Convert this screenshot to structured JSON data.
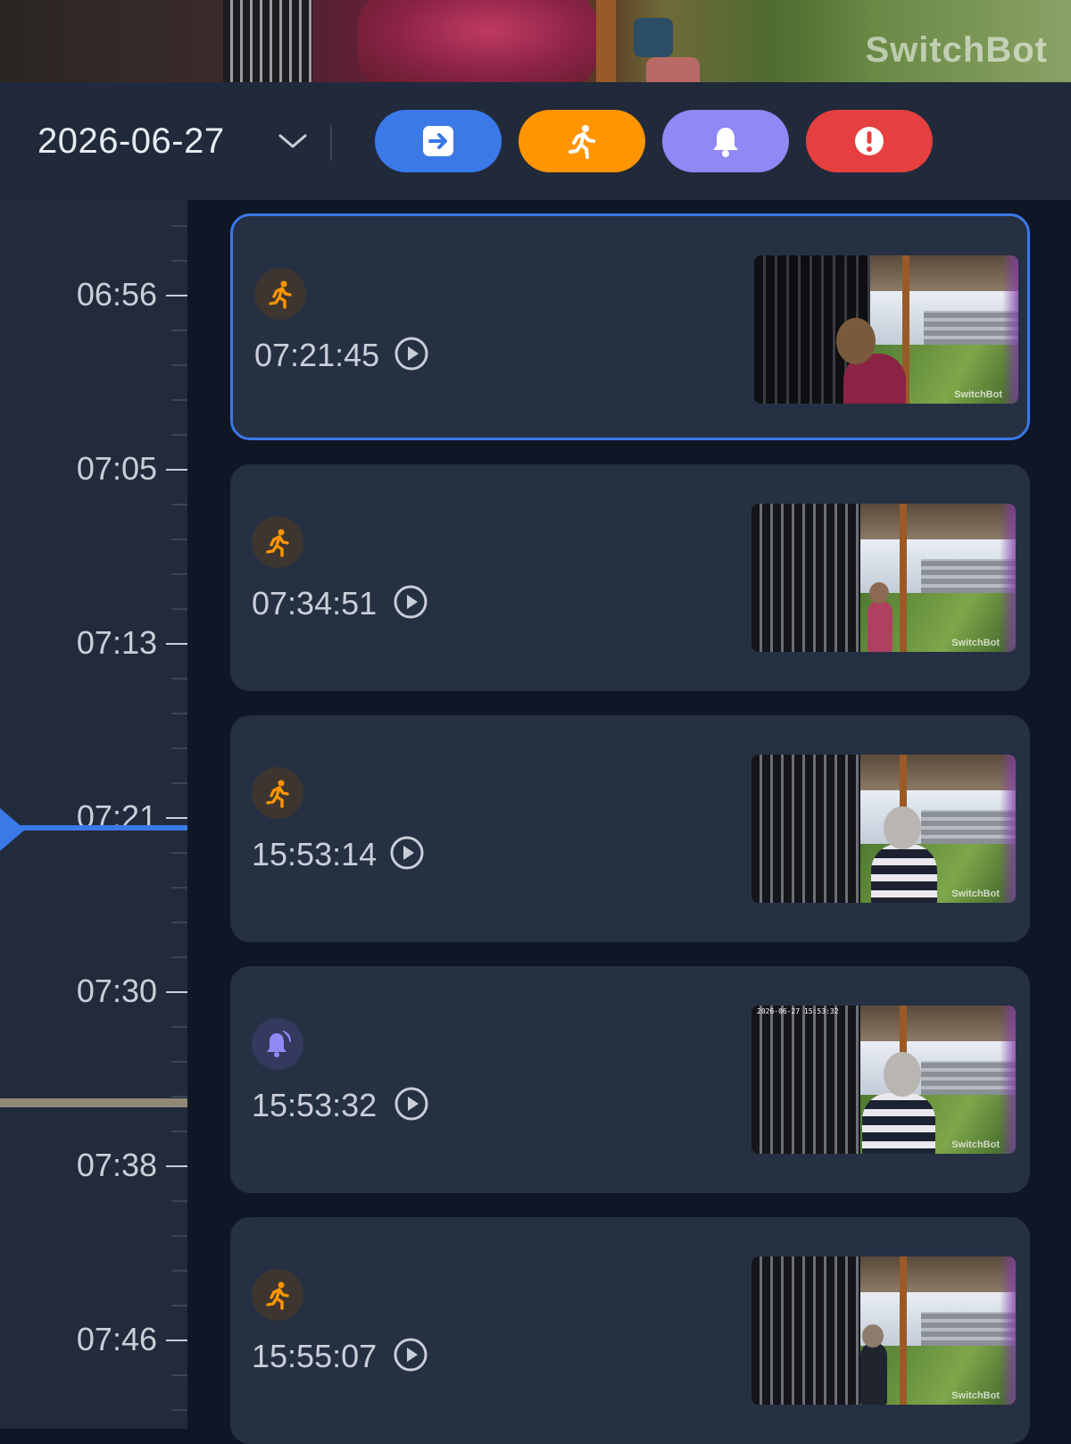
{
  "live_view": {
    "watermark": "SwitchBot"
  },
  "header": {
    "date": "2026-06-27",
    "filters": [
      {
        "name": "filter-all",
        "icon": "enter-icon",
        "color": "#3b78e8"
      },
      {
        "name": "filter-motion",
        "icon": "running-person-icon",
        "color": "#ff9500"
      },
      {
        "name": "filter-doorbell",
        "icon": "bell-icon",
        "color": "#8f88f5"
      },
      {
        "name": "filter-alert",
        "icon": "exclamation-icon",
        "color": "#e5403f"
      }
    ]
  },
  "timeline": {
    "labels": [
      "06:56",
      "07:05",
      "07:13",
      "07:21",
      "07:30",
      "07:38",
      "07:46"
    ],
    "cursor_time": "07:21",
    "cursor_color": "#3b78e8"
  },
  "events": [
    {
      "type": "motion",
      "icon": "running-person-icon",
      "time": "07:21:45",
      "selected": true,
      "thumb_watermark": "SwitchBot"
    },
    {
      "type": "motion",
      "icon": "running-person-icon",
      "time": "07:34:51",
      "selected": false,
      "thumb_watermark": "SwitchBot"
    },
    {
      "type": "motion",
      "icon": "running-person-icon",
      "time": "15:53:14",
      "selected": false,
      "thumb_watermark": "SwitchBot"
    },
    {
      "type": "doorbell",
      "icon": "bell-icon",
      "time": "15:53:32",
      "selected": false,
      "thumb_watermark": "SwitchBot",
      "thumb_stamp": "2026-06-27 15:53:32"
    },
    {
      "type": "motion",
      "icon": "running-person-icon",
      "time": "15:55:07",
      "selected": false,
      "thumb_watermark": "SwitchBot"
    }
  ]
}
